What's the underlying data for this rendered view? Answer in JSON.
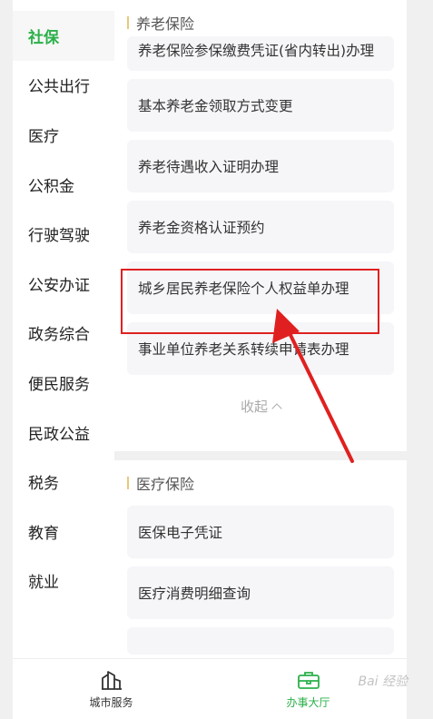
{
  "sidebar": {
    "items": [
      {
        "label": "社保",
        "active": true
      },
      {
        "label": "公共出行"
      },
      {
        "label": "医疗"
      },
      {
        "label": "公积金"
      },
      {
        "label": "行驶驾驶"
      },
      {
        "label": "公安办证"
      },
      {
        "label": "政务综合"
      },
      {
        "label": "便民服务"
      },
      {
        "label": "民政公益"
      },
      {
        "label": "税务"
      },
      {
        "label": "教育"
      },
      {
        "label": "就业"
      }
    ]
  },
  "pension": {
    "title": "养老保险",
    "items": [
      "养老保险参保缴费凭证(省内转出)办理",
      "基本养老金领取方式变更",
      "养老待遇收入证明办理",
      "养老金资格认证预约",
      "城乡居民养老保险个人权益单办理",
      "事业单位养老关系转续申请表办理"
    ],
    "collapse_label": "收起"
  },
  "medical": {
    "title": "医疗保险",
    "items": [
      "医保电子凭证",
      "医疗消费明细查询"
    ]
  },
  "bottom_nav": {
    "city_service": "城市服务",
    "office_hall": "办事大厅"
  },
  "watermark": "Bai 经验",
  "colors": {
    "accent": "#2bb04a",
    "highlight": "#e02020",
    "section_bar": "#e8c87a"
  }
}
